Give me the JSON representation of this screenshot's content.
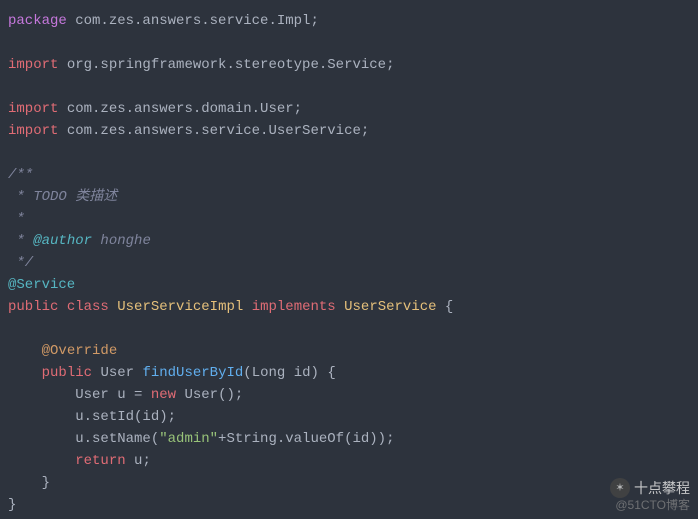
{
  "code": {
    "line1_pkg": "package",
    "line1_rest": " com.zes.answers.service.Impl;",
    "line3_imp": "import",
    "line3_rest": " org.springframework.stereotype.Service;",
    "line5_imp": "import",
    "line5_rest": " com.zes.answers.domain.User;",
    "line6_imp": "import",
    "line6_rest": " com.zes.answers.service.UserService;",
    "c1": "/**",
    "c2": " * TODO 类描述",
    "c3": " *",
    "c4_pre": " * ",
    "c4_at": "@author",
    "c4_post": " honghe",
    "c5": " */",
    "ann_service": "@Service",
    "kw_public": "public",
    "kw_class": "class",
    "cls_impl": "UserServiceImpl",
    "kw_implements": "implements",
    "cls_iface": "UserService",
    "brace_open": " {",
    "ann_override": "@Override",
    "ret_type": "User",
    "method_name": "findUserById",
    "param_type": "Long",
    "param_name": "id",
    "paren_brace": ") {",
    "body1_type": "User",
    "body1_var": " u = ",
    "kw_new": "new",
    "body1_ctor": " User();",
    "body2": "u.setId(id);",
    "body3_pre": "u.setName(",
    "body3_str": "\"admin\"",
    "body3_post": "+String.valueOf(id));",
    "kw_return": "return",
    "body4_post": " u;",
    "brace_close_m": "}",
    "brace_close_c": "}"
  },
  "watermark": {
    "main": "十点攀程",
    "sub": "@51CTO博客"
  }
}
